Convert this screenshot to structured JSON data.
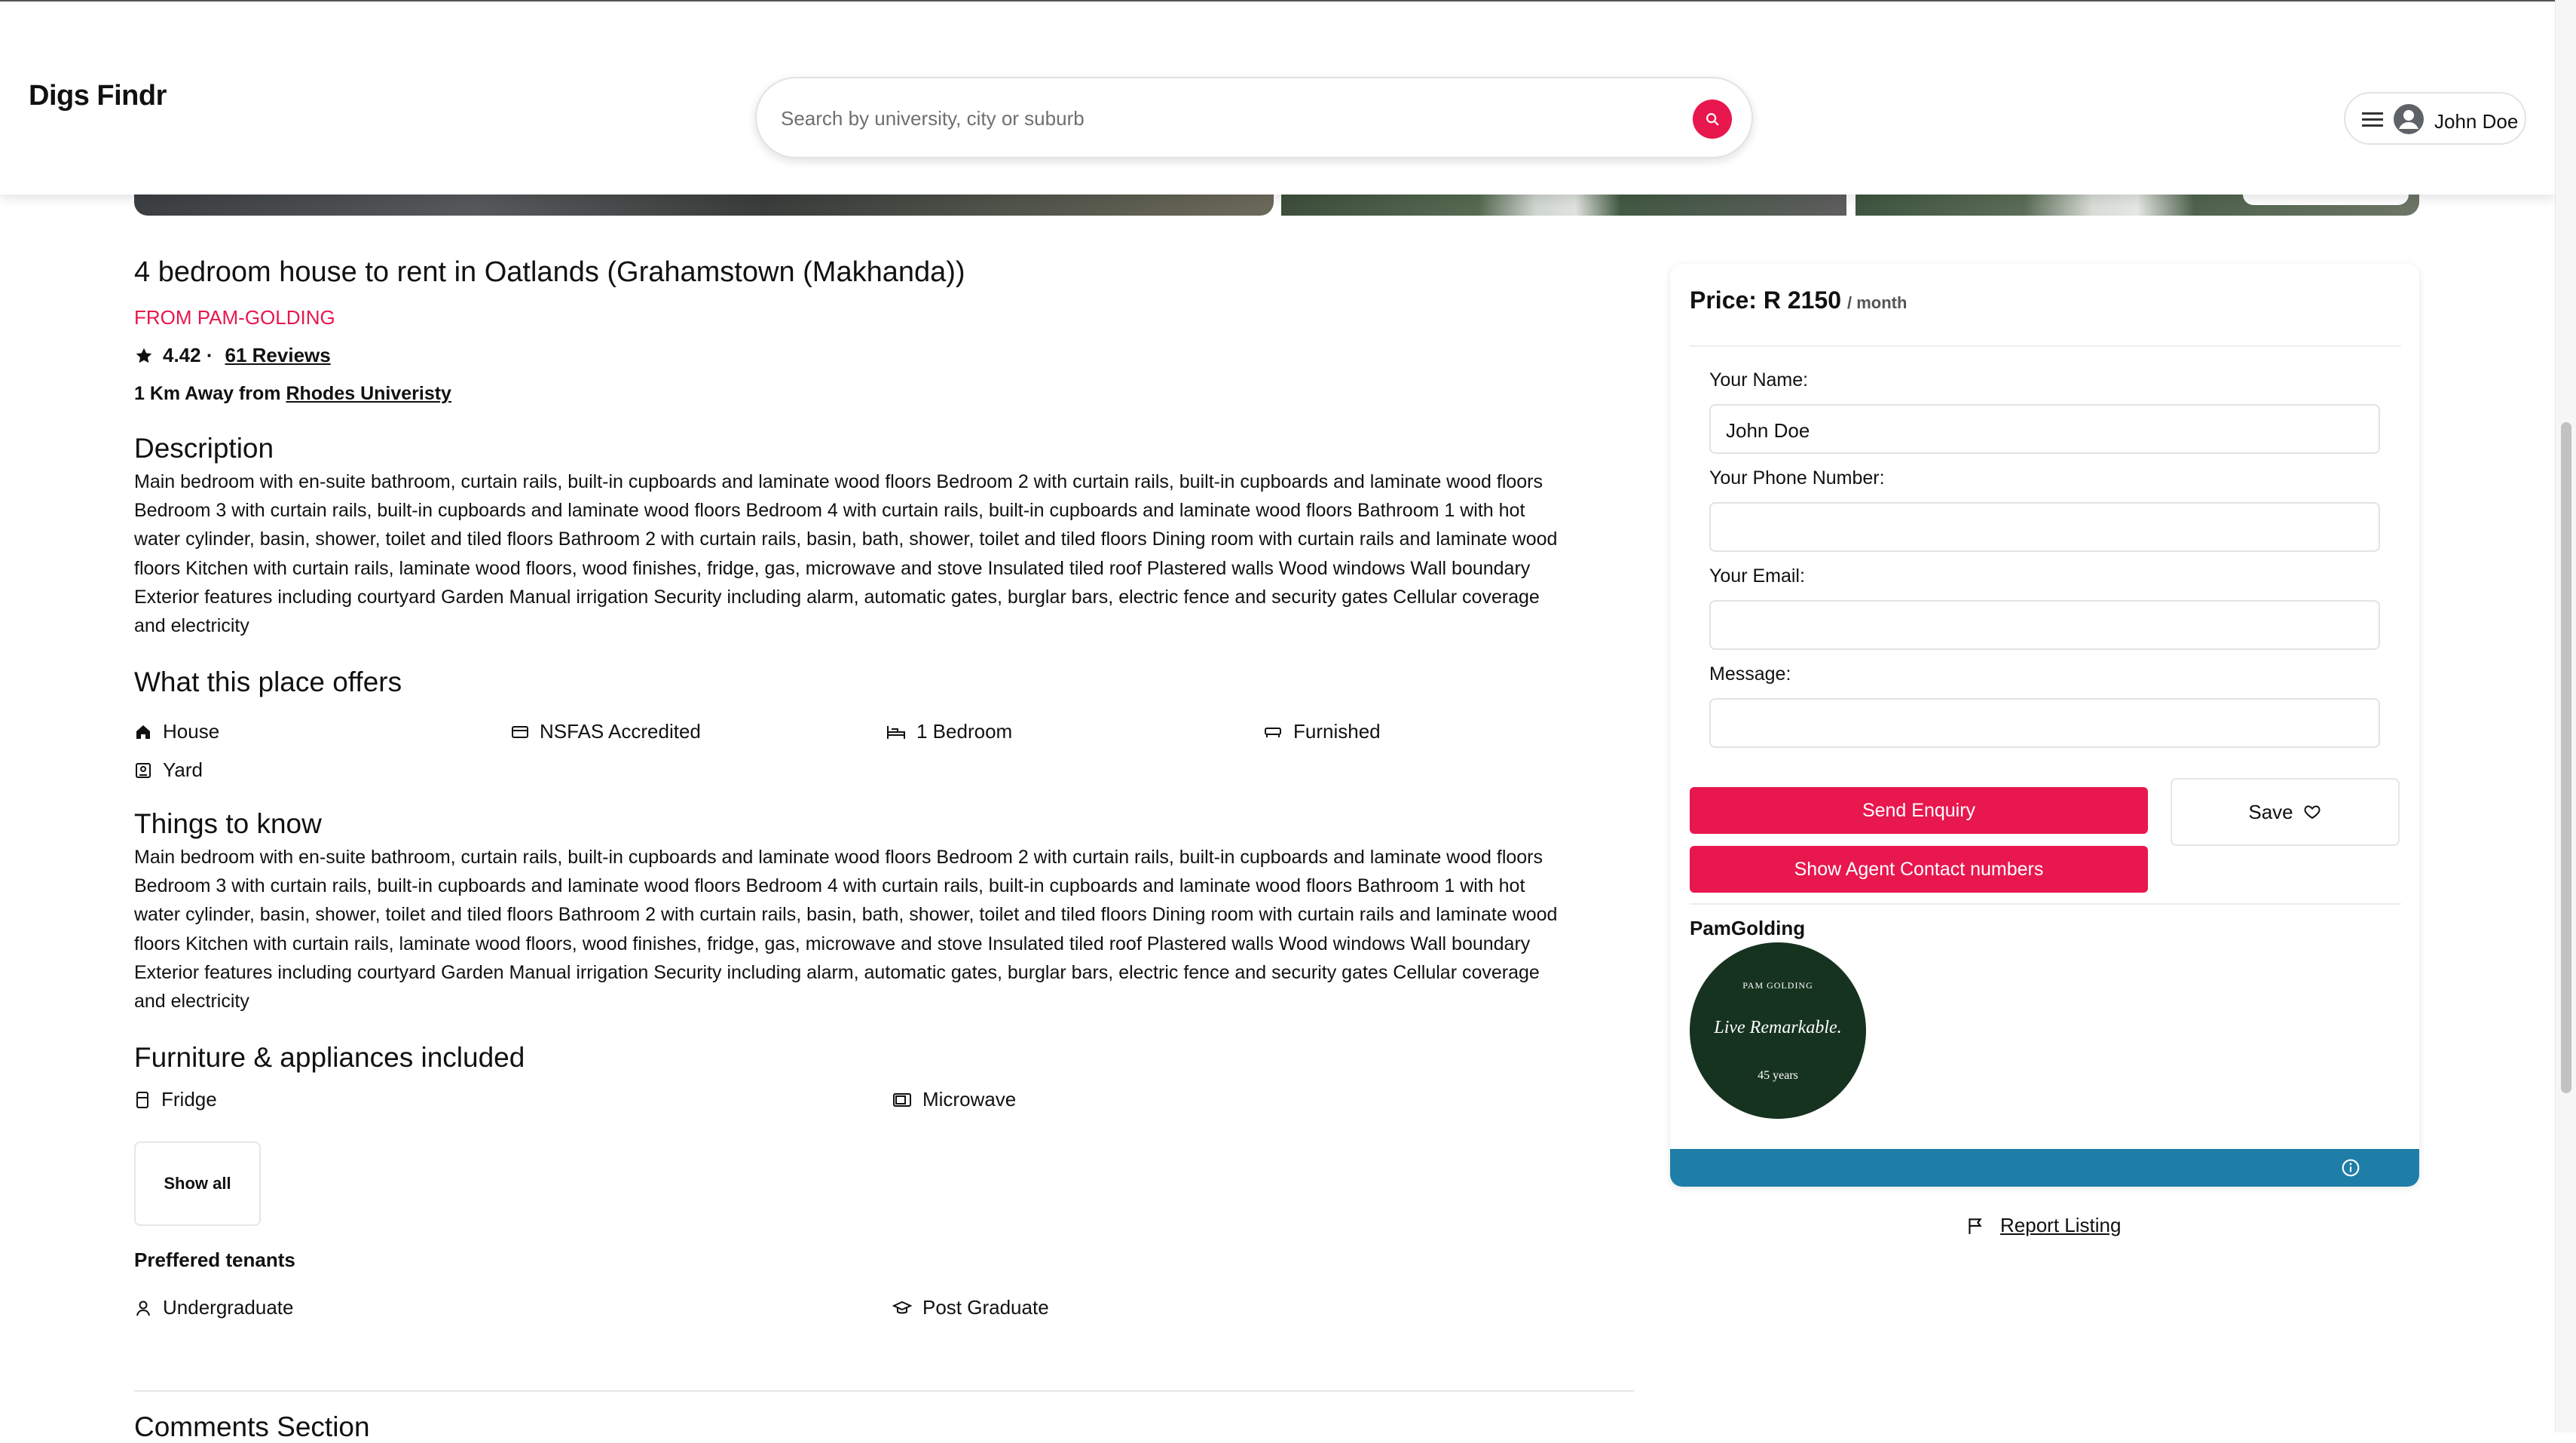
{
  "brand": {
    "name": "Digs Findr",
    "accent": "#e8174e",
    "info_bar": "#1f7ea8"
  },
  "search": {
    "placeholder": "Search by university, city or suburb",
    "icon": "search-icon"
  },
  "user": {
    "name": "John Doe",
    "menu_icon": "hamburger-icon",
    "avatar_icon": "user-avatar-icon"
  },
  "listing": {
    "title": "4 bedroom house to rent in Oatlands (Grahamstown (Makhanda))",
    "from": "FROM PAM-GOLDING",
    "rating": "4.42 ·",
    "reviews": "61 Reviews",
    "distance_prefix": "1 Km Away from ",
    "university": "Rhodes Univeristy",
    "description_heading": "Description",
    "description_lines": [
      "Main bedroom with en-suite bathroom, curtain rails, built-in cupboards and laminate wood floors Bedroom 2 with curtain rails, built-in cupboards and laminate wood floors",
      "Bedroom 3 with curtain rails, built-in cupboards and laminate wood floors Bedroom 4 with curtain rails, built-in cupboards and laminate wood floors Bathroom 1 with hot",
      "water cylinder, basin, shower, toilet and tiled floors Bathroom 2 with curtain rails, basin, bath, shower, toilet and tiled floors Dining room with curtain rails and laminate wood",
      "floors Kitchen with curtain rails, laminate wood floors, wood finishes, fridge, gas, microwave and stove Insulated tiled roof Plastered walls Wood windows Wall boundary",
      "Exterior features including courtyard Garden Manual irrigation Security including alarm, automatic gates, burglar bars, electric fence and security gates Cellular coverage",
      "and electricity"
    ],
    "offers_heading": "What this place offers",
    "offers": [
      {
        "label": "House",
        "icon": "home-icon"
      },
      {
        "label": "NSFAS Accredited",
        "icon": "card-icon"
      },
      {
        "label": "1 Bedroom",
        "icon": "bed-icon"
      },
      {
        "label": "Furnished",
        "icon": "sofa-icon"
      },
      {
        "label": "Yard",
        "icon": "yard-icon"
      }
    ],
    "things_heading": "Things to know",
    "things_lines": [
      "Main bedroom with en-suite bathroom, curtain rails, built-in cupboards and laminate wood floors Bedroom 2 with curtain rails, built-in cupboards and laminate wood floors",
      "Bedroom 3 with curtain rails, built-in cupboards and laminate wood floors Bedroom 4 with curtain rails, built-in cupboards and laminate wood floors Bathroom 1 with hot",
      "water cylinder, basin, shower, toilet and tiled floors Bathroom 2 with curtain rails, basin, bath, shower, toilet and tiled floors Dining room with curtain rails and laminate wood",
      "floors Kitchen with curtain rails, laminate wood floors, wood finishes, fridge, gas, microwave and stove Insulated tiled roof Plastered walls Wood windows Wall boundary",
      "Exterior features including courtyard Garden Manual irrigation Security including alarm, automatic gates, burglar bars, electric fence and security gates Cellular coverage",
      "and electricity"
    ],
    "furniture_heading": "Furniture & appliances included",
    "furniture": [
      {
        "label": "Fridge",
        "icon": "fridge-icon"
      },
      {
        "label": "Microwave",
        "icon": "microwave-icon"
      }
    ],
    "show_all": "Show all",
    "tenants_heading": "Preffered tenants",
    "tenants": [
      {
        "label": "Undergraduate",
        "icon": "person-icon"
      },
      {
        "label": "Post Graduate",
        "icon": "graduation-cap-icon"
      }
    ],
    "comments_heading": "Comments Section"
  },
  "enquiry": {
    "price_label": "Price: R 2150",
    "per": "/ month",
    "name_label": "Your Name:",
    "name_value": "John Doe",
    "phone_label": "Your Phone Number:",
    "phone_value": "",
    "email_label": "Your Email:",
    "email_value": "",
    "message_label": "Message:",
    "message_value": "",
    "send": "Send Enquiry",
    "show_numbers": "Show Agent Contact numbers",
    "save": "Save",
    "agency": "PamGolding",
    "logo_top": "PAM GOLDING",
    "logo_tagline": "Live Remarkable.",
    "logo_years": "45 years"
  },
  "report": {
    "label": "Report Listing",
    "icon": "flag-icon"
  }
}
